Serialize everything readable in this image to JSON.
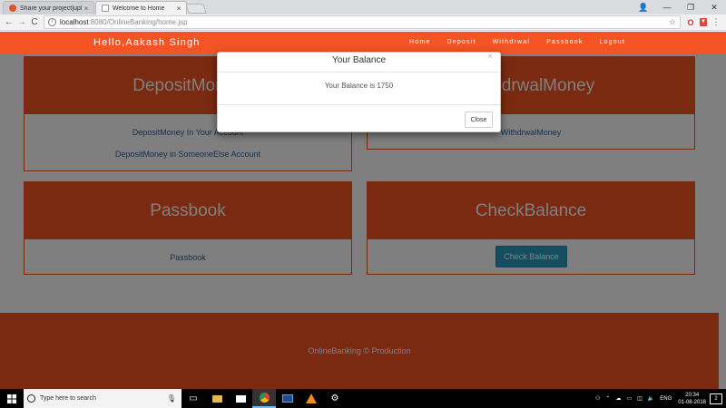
{
  "browser": {
    "tabs": [
      {
        "label": "Share your project|upload",
        "close": "×"
      },
      {
        "label": "Welcome to Home",
        "close": "×"
      }
    ],
    "window_controls": {
      "user": "👤",
      "minimize": "—",
      "maximize": "❐",
      "close": "✕"
    },
    "address": {
      "host": "localhost",
      "path": ":8080/OnlineBanking/home.jsp"
    },
    "nav": {
      "back": "←",
      "forward": "→",
      "reload": "C"
    }
  },
  "navbar": {
    "brand": "Hello,Aakash Singh",
    "links": [
      "Home",
      "Deposit",
      "Withdrwal",
      "Passbook",
      "Logout"
    ]
  },
  "cards": {
    "deposit": {
      "title": "DepositMoney",
      "links": [
        "DepositMoney In Your Account",
        "DepositMoney in SomeoneElse Account"
      ]
    },
    "withdraw": {
      "title": "WithdrwalMoney",
      "links": [
        "WithdrwalMoney"
      ]
    },
    "passbook": {
      "title": "Passbook",
      "links": [
        "Passbook"
      ]
    },
    "balance": {
      "title": "CheckBalance",
      "button": "Check Balance"
    }
  },
  "footer": {
    "text": "OnlineBanking © Production"
  },
  "modal": {
    "title": "Your Balance",
    "close_x": "×",
    "message": "Your Balance is 1750",
    "close_button": "Close"
  },
  "taskbar": {
    "search_placeholder": "Type here to search",
    "tray": {
      "language": "ENG",
      "time": "20:34",
      "date": "01-08-2018",
      "notifications": "2"
    }
  },
  "colors": {
    "accent": "#f45423",
    "link": "#2a6496",
    "button": "#2a9bc2"
  }
}
